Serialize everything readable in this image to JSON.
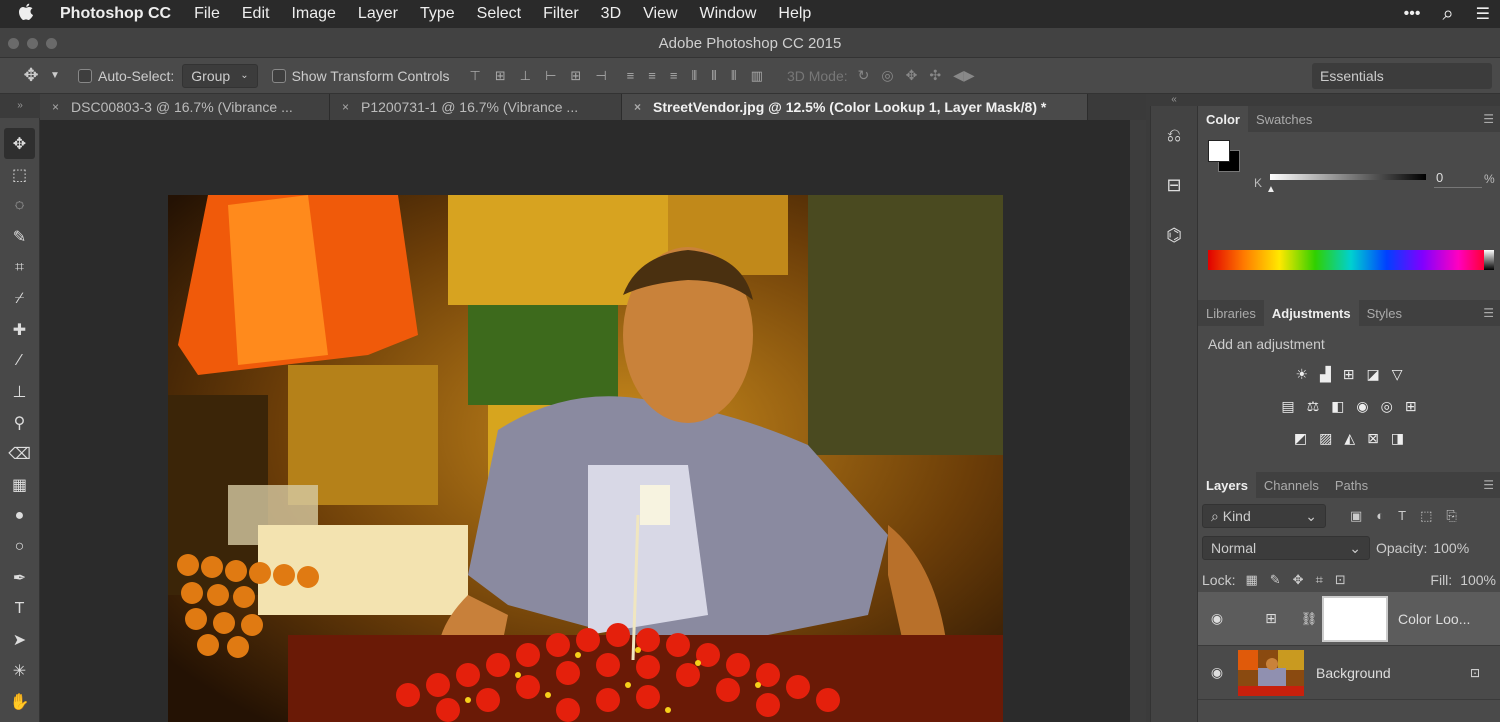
{
  "menubar": {
    "apple": "",
    "app_name": "Photoshop CC",
    "items": [
      "File",
      "Edit",
      "Image",
      "Layer",
      "Type",
      "Select",
      "Filter",
      "3D",
      "View",
      "Window",
      "Help"
    ],
    "right_icons": [
      "ellipsis-icon",
      "search-icon",
      "list-icon"
    ],
    "ellipsis": "•••",
    "search": "⌕",
    "list": "☰"
  },
  "window": {
    "title": "Adobe Photoshop CC 2015"
  },
  "options": {
    "move_tool": "✥",
    "auto_select_label": "Auto-Select:",
    "auto_select_value": "Group",
    "transform_label": "Show Transform Controls",
    "mode_3d_label": "3D Mode:",
    "workspace": "Essentials"
  },
  "tabs": [
    {
      "close": "×",
      "label": "DSC00803-3 @ 16.7% (Vibrance ..."
    },
    {
      "close": "×",
      "label": "P1200731-1 @ 16.7% (Vibrance ..."
    },
    {
      "close": "×",
      "label": "StreetVendor.jpg @ 12.5% (Color Lookup 1, Layer Mask/8) *"
    }
  ],
  "tools": [
    "move-tool-icon",
    "marquee-tool-icon",
    "lasso-tool-icon",
    "quick-select-tool-icon",
    "crop-tool-icon",
    "eyedropper-tool-icon",
    "healing-tool-icon",
    "brush-tool-icon",
    "stamp-tool-icon",
    "history-brush-tool-icon",
    "eraser-tool-icon",
    "gradient-tool-icon",
    "blur-tool-icon",
    "dodge-tool-icon",
    "pen-tool-icon",
    "type-tool-icon",
    "path-select-tool-icon",
    "custom-shape-tool-icon",
    "hand-tool-icon"
  ],
  "tool_glyphs": [
    "✥",
    "⬚",
    "◌",
    "✎",
    "⌗",
    "⌿",
    "✚",
    "∕",
    "⊥",
    "⚲",
    "⌫",
    "▦",
    "●",
    "○",
    "✒",
    "T",
    "➤",
    "✳",
    "✋"
  ],
  "color_panel": {
    "tabs": [
      "Color",
      "Swatches"
    ],
    "k_label": "K",
    "k_value": "0",
    "k_unit": "%",
    "foreground": "#ffffff",
    "background": "#000000"
  },
  "adjust_panel": {
    "tabs": [
      "Libraries",
      "Adjustments",
      "Styles"
    ],
    "heading": "Add an adjustment",
    "row1": [
      "☀",
      "▟",
      "⊞",
      "◪",
      "▽"
    ],
    "row2": [
      "▤",
      "⚖",
      "◧",
      "◉",
      "◎",
      "⊞"
    ],
    "row3": [
      "◩",
      "▨",
      "◭",
      "⊠",
      "◨"
    ]
  },
  "layers_panel": {
    "tabs": [
      "Layers",
      "Channels",
      "Paths"
    ],
    "filter_label": "Kind",
    "blend_mode": "Normal",
    "opacity_label": "Opacity:",
    "opacity_value": "100%",
    "lock_label": "Lock:",
    "fill_label": "Fill:",
    "fill_value": "100%",
    "layers": [
      {
        "name": "Color Loo...",
        "visible": true
      },
      {
        "name": "Background",
        "visible": true,
        "locked": true
      }
    ],
    "eye": "◉",
    "lock": "🔒",
    "chain": "⛓",
    "adj_glyph": "⊞"
  },
  "mini_panel_icons": [
    "history-icon",
    "properties-icon",
    "paths-icon"
  ],
  "mini_glyphs": [
    "⎌",
    "⊟",
    "⌬"
  ]
}
